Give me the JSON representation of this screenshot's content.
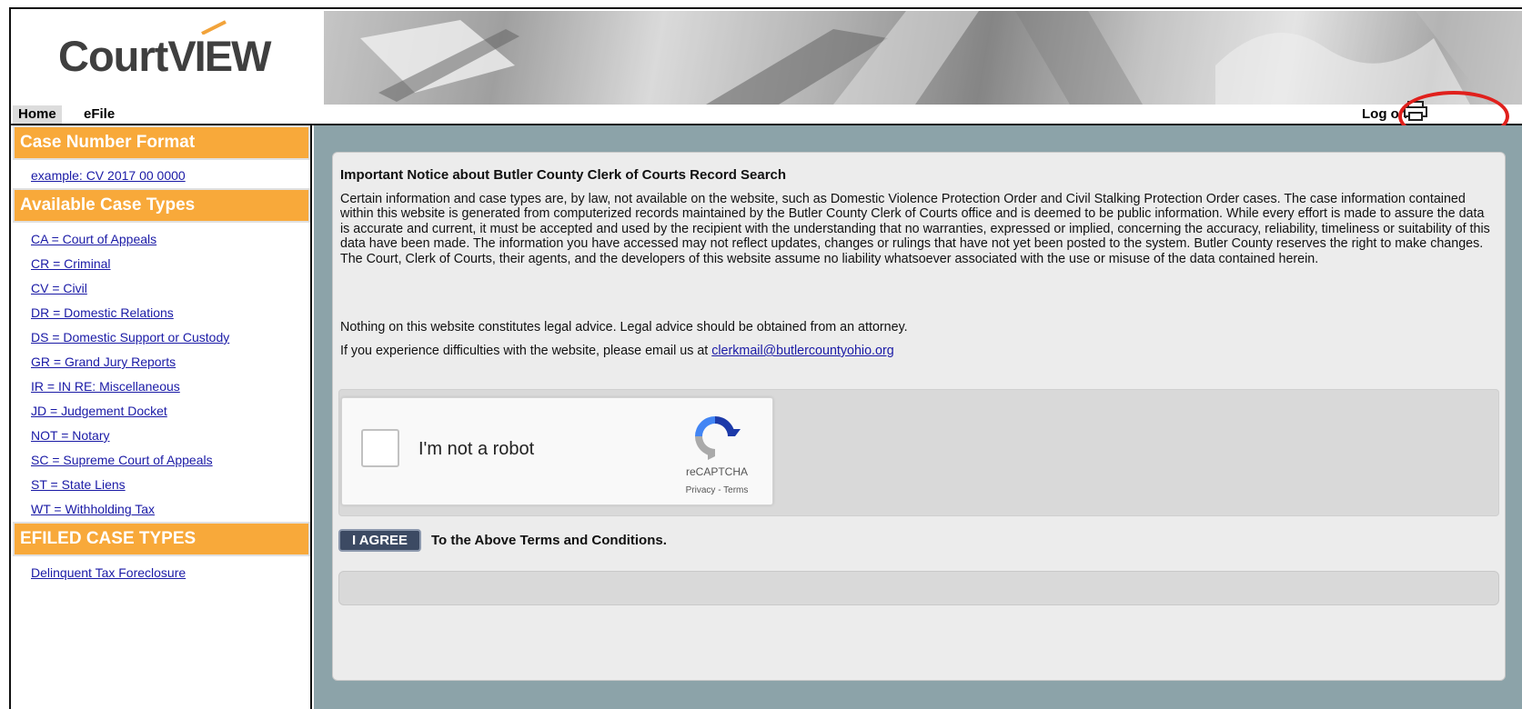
{
  "header": {
    "logo_text_1": "Court",
    "logo_text_2": "VIEW"
  },
  "nav": {
    "home": "Home",
    "efile": "eFile",
    "logon": "Log on"
  },
  "sidebar": {
    "section1_title": "Case Number Format",
    "section1_items": [
      "example: CV 2017 00 0000"
    ],
    "section2_title": "Available Case Types",
    "section2_items": [
      "CA = Court of Appeals",
      "CR = Criminal",
      "CV = Civil",
      "DR = Domestic Relations",
      "DS = Domestic Support or Custody",
      "GR = Grand Jury Reports",
      "IR = IN RE: Miscellaneous",
      "JD = Judgement Docket",
      "NOT = Notary",
      "SC = Supreme Court of Appeals",
      "ST = State Liens",
      "WT = Withholding Tax"
    ],
    "section3_title": "EFILED CASE TYPES",
    "section3_items": [
      "Delinquent Tax Foreclosure"
    ]
  },
  "notice": {
    "title": "Important Notice about Butler County Clerk of Courts Record Search",
    "body": "Certain information and case types are, by law, not available on the website, such as  Domestic Violence Protection Order and Civil Stalking Protection Order cases.  The case information contained within this website is generated from computerized records maintained by the Butler County Clerk of Courts office and is deemed to be public information.  While every effort is made to assure the data is accurate and current, it must be accepted and used by the recipient with the understanding that no warranties, expressed or implied, concerning the accuracy, reliability, timeliness or suitability of this data have been made.  The information you have accessed may not reflect updates, changes or rulings that have not yet been posted to the system.  Butler County reserves the right to make changes.  The Court, Clerk of Courts, their agents, and the developers of this website assume no liability whatsoever associated with the use or misuse of the data contained herein.",
    "legal": "Nothing on this website constitutes legal advice.  Legal advice should be obtained from an attorney.",
    "contact_prefix": "If you experience difficulties with the website, please email us at ",
    "contact_email": "clerkmail@butlercountyohio.org"
  },
  "captcha": {
    "label": "I'm not a robot",
    "brand": "reCAPTCHA",
    "links": "Privacy - Terms"
  },
  "agree": {
    "button": "I AGREE",
    "text": "To the Above Terms and Conditions."
  },
  "colors": {
    "sidebar_header": "#f8a93a",
    "content_bg": "#8ca3a9",
    "link": "#1a1aa6",
    "agree_button": "#3c4a63",
    "highlight_circle": "#e0201c"
  }
}
